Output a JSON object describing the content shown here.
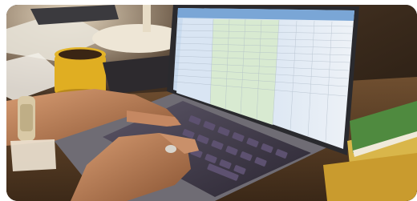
{
  "scene": {
    "subject": "hands-typing-on-laptop",
    "objects": [
      "laptop",
      "spreadsheet-screen",
      "keyboard",
      "hands",
      "wristwatch",
      "yellow-mug",
      "desk-lamp",
      "eraser",
      "book-stack",
      "papers"
    ],
    "palette": {
      "desk_wood": "#6b4a2b",
      "shadow": "#1c140d",
      "screen_bg": "#e9eef5",
      "sheet_header_blue": "#7aa6d6",
      "sheet_green_band": "#d8ead1",
      "sheet_blue_band": "#d9e5f3",
      "laptop_body": "#4b4a52",
      "keyboard": "#2f2a3a",
      "key": "#55496a",
      "skin": "#c48a63",
      "mug": "#e3b52b",
      "lamp": "#efe6d4",
      "eraser": "#e8587a",
      "book_green": "#4f8a3f",
      "book_yellow": "#d9b64a"
    }
  }
}
